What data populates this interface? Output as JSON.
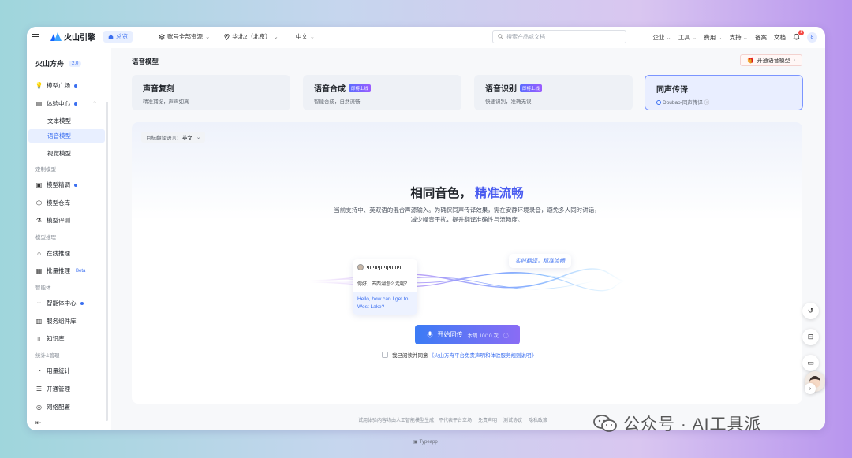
{
  "topbar": {
    "brand": "火山引擎",
    "home_label": "总览",
    "account_scope": "账号全部资源",
    "region": "华北2（北京）",
    "language": "中文",
    "search_placeholder": "搜索产品或文档",
    "right_menu": [
      "企业",
      "工具",
      "费用",
      "支持",
      "备案",
      "文档"
    ],
    "notification_count": "1",
    "user_initial": "8"
  },
  "sidebar": {
    "title": "火山方舟",
    "version": "2.0",
    "items": {
      "model_square": "模型广场",
      "experience_center": "体验中心",
      "text_model": "文本模型",
      "voice_model": "语音模型",
      "vision_model": "视觉模型",
      "group_custom": "定制模型",
      "fine_tune": "模型精调",
      "model_repo": "模型仓库",
      "model_eval": "模型评测",
      "group_inference": "模型推理",
      "online_inference": "在线推理",
      "batch_inference": "批量推理",
      "beta": "Beta",
      "group_agent": "智能体",
      "agent_center": "智能体中心",
      "service_components": "服务组件库",
      "knowledge_base": "知识库",
      "group_stats": "统计&管理",
      "usage_stats": "用量统计",
      "activation_mgmt": "开通管理",
      "network_config": "网络配置"
    }
  },
  "main": {
    "page_title": "语音模型",
    "open_button": "开通语音模型",
    "cards": [
      {
        "title": "声音复刻",
        "subtitle": "精准捕捉，声声如真",
        "badge": ""
      },
      {
        "title": "语音合成",
        "subtitle": "智能合成，自然流畅",
        "badge": "即将上线"
      },
      {
        "title": "语音识别",
        "subtitle": "快速识别，准确无误",
        "badge": "即将上线"
      },
      {
        "title": "同声传译",
        "subtitle": "Doubao-同声传译",
        "badge": ""
      }
    ],
    "target_lang_label": "目标翻译语言:",
    "target_lang_value": "英文",
    "hero_title_a": "相同音色，",
    "hero_title_b": "精准流畅",
    "hero_desc_line1": "当前支持中、英双语的混合声源输入。为确保同声传译效果，需在安静环境录音，避免多人同时讲话，",
    "hero_desc_line2": "减少噪音干扰，提升翻译准确性与流畅度。",
    "demo_question": "你好，去西湖怎么走呢？",
    "demo_answer": "Hello, how can I get to West Lake?",
    "realtime_tag": "实时翻译，精准流畅",
    "start_button": "开始同传",
    "quota_text": "本周 10/10 次",
    "agree_text": "我已阅读并同意",
    "agree_link": "《火山方舟平台免责声明和体验服务规则说明》",
    "footer": [
      "试用体验内容均由人工智能模型生成，不代表平台立场",
      "免责声明",
      "测试协议",
      "隐私政策"
    ]
  },
  "watermark": "公众号 · AI工具派",
  "bottom_caption": "Typeapp",
  "colors": {
    "accent": "#3b6ff0",
    "hero_highlight": "#4a5cf0"
  }
}
